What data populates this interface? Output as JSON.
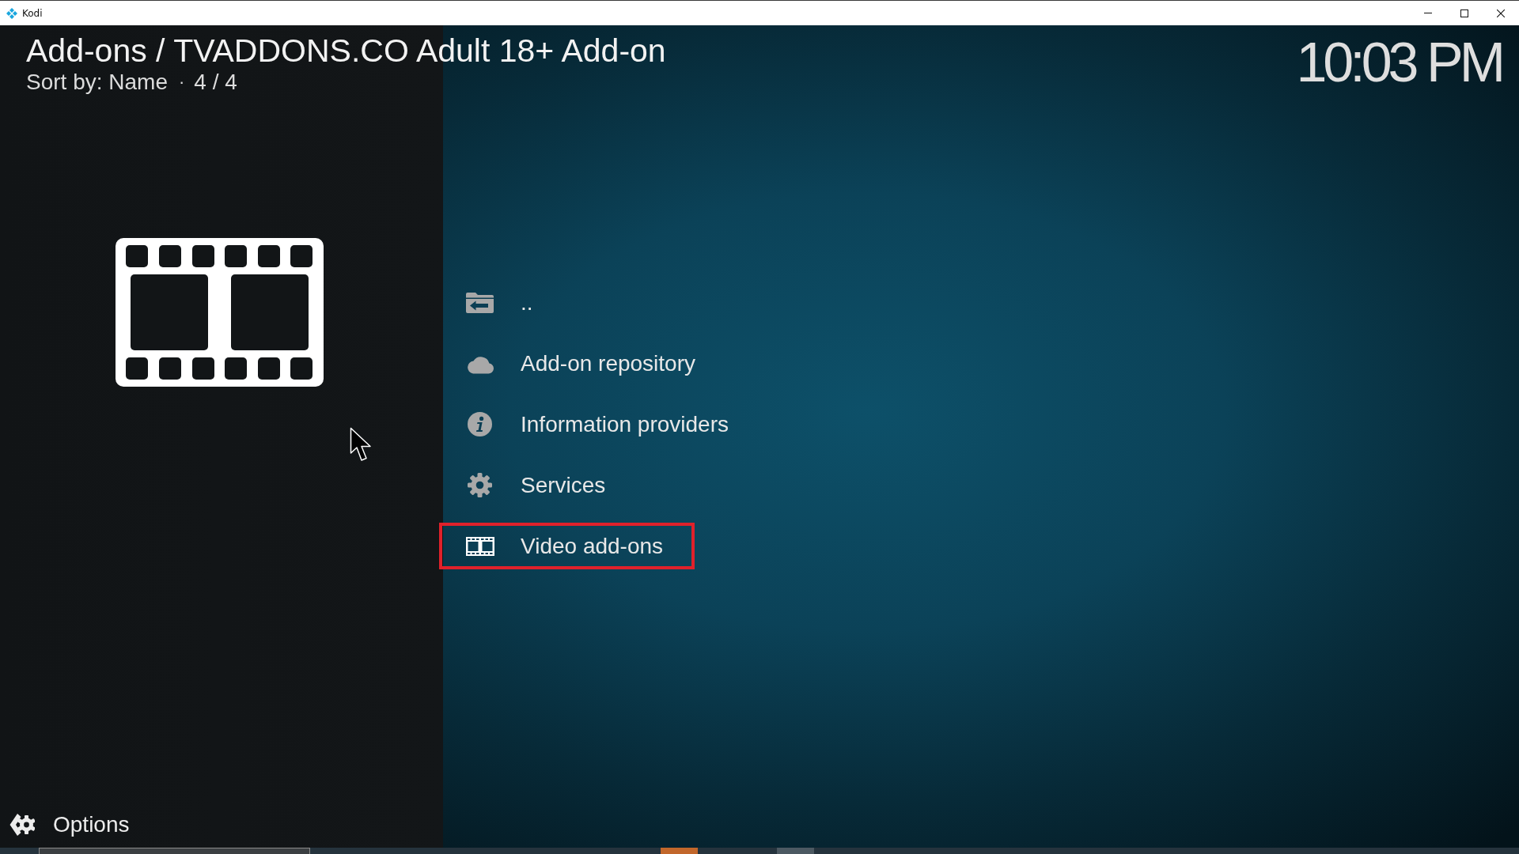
{
  "window": {
    "title": "Kodi"
  },
  "header": {
    "breadcrumb": "Add-ons / TVADDONS.CO Adult 18+ Add-on",
    "sort_label": "Sort by: Name",
    "separator": "·",
    "count": "4 / 4"
  },
  "clock": "10:03 PM",
  "items": [
    {
      "kind": "parent",
      "label": "..",
      "selected": false
    },
    {
      "kind": "repository",
      "label": "Add-on repository",
      "selected": false
    },
    {
      "kind": "info",
      "label": "Information providers",
      "selected": false
    },
    {
      "kind": "services",
      "label": "Services",
      "selected": false
    },
    {
      "kind": "video",
      "label": "Video add-ons",
      "selected": true
    }
  ],
  "footer": {
    "options_label": "Options"
  }
}
